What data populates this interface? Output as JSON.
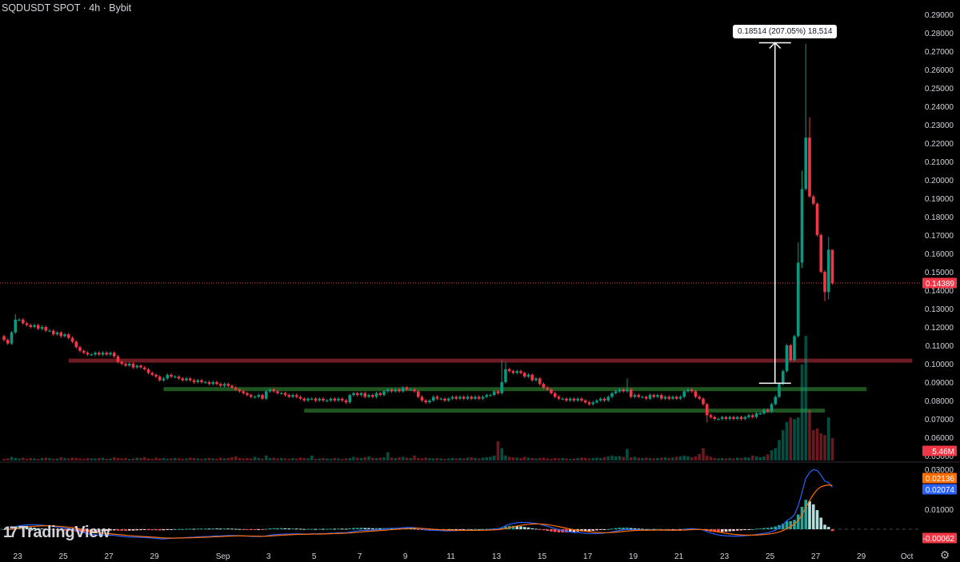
{
  "header": {
    "title": "SQDUSDT SPOT · 4h · Bybit"
  },
  "logo": {
    "text": "TradingView",
    "mark": "17"
  },
  "icons": {
    "settings": "gear-icon"
  },
  "colors": {
    "up": "#089981",
    "down": "#f23645",
    "macd": "#2962ff",
    "signal": "#ff6d00",
    "resistance": "#7a1f27",
    "support": "#1f5a22"
  },
  "chart_data": {
    "type": "candlestick",
    "symbol": "SQDUSDT",
    "interval": "4h",
    "exchange": "Bybit",
    "first_open": 0.115,
    "closes": [
      0.113,
      0.111,
      0.117,
      0.124,
      0.124,
      0.122,
      0.121,
      0.12,
      0.121,
      0.119,
      0.12,
      0.118,
      0.118,
      0.116,
      0.117,
      0.115,
      0.116,
      0.114,
      0.112,
      0.109,
      0.107,
      0.106,
      0.105,
      0.105,
      0.106,
      0.105,
      0.106,
      0.105,
      0.106,
      0.104,
      0.101,
      0.1,
      0.099,
      0.1,
      0.098,
      0.099,
      0.098,
      0.097,
      0.095,
      0.094,
      0.093,
      0.091,
      0.092,
      0.094,
      0.093,
      0.093,
      0.092,
      0.091,
      0.092,
      0.091,
      0.09,
      0.091,
      0.09,
      0.09,
      0.089,
      0.09,
      0.089,
      0.088,
      0.089,
      0.088,
      0.087,
      0.086,
      0.085,
      0.084,
      0.083,
      0.082,
      0.082,
      0.083,
      0.081,
      0.085,
      0.086,
      0.085,
      0.084,
      0.084,
      0.083,
      0.082,
      0.083,
      0.082,
      0.081,
      0.08,
      0.081,
      0.081,
      0.08,
      0.081,
      0.08,
      0.08,
      0.081,
      0.08,
      0.081,
      0.08,
      0.079,
      0.083,
      0.084,
      0.083,
      0.084,
      0.082,
      0.083,
      0.082,
      0.084,
      0.083,
      0.085,
      0.086,
      0.085,
      0.086,
      0.085,
      0.087,
      0.086,
      0.086,
      0.085,
      0.082,
      0.08,
      0.079,
      0.08,
      0.082,
      0.081,
      0.081,
      0.08,
      0.081,
      0.082,
      0.081,
      0.082,
      0.081,
      0.082,
      0.081,
      0.082,
      0.081,
      0.082,
      0.083,
      0.083,
      0.085,
      0.084,
      0.09,
      0.097,
      0.096,
      0.095,
      0.096,
      0.095,
      0.093,
      0.094,
      0.091,
      0.092,
      0.089,
      0.087,
      0.086,
      0.084,
      0.082,
      0.081,
      0.081,
      0.08,
      0.081,
      0.08,
      0.081,
      0.08,
      0.079,
      0.078,
      0.079,
      0.08,
      0.081,
      0.08,
      0.082,
      0.084,
      0.085,
      0.086,
      0.085,
      0.086,
      0.082,
      0.083,
      0.082,
      0.082,
      0.081,
      0.083,
      0.082,
      0.083,
      0.081,
      0.082,
      0.081,
      0.082,
      0.081,
      0.082,
      0.085,
      0.086,
      0.085,
      0.082,
      0.081,
      0.078,
      0.072,
      0.071,
      0.07,
      0.07,
      0.071,
      0.07,
      0.071,
      0.07,
      0.071,
      0.07,
      0.071,
      0.072,
      0.071,
      0.073,
      0.073,
      0.075,
      0.074,
      0.078,
      0.082,
      0.089,
      0.096,
      0.11,
      0.102,
      0.115,
      0.155,
      0.195,
      0.223,
      0.191,
      0.187,
      0.17,
      0.15,
      0.139,
      0.162,
      0.14389
    ],
    "wick_overrides": [
      {
        "i": 3,
        "h": 0.127
      },
      {
        "i": 131,
        "h": 0.102
      },
      {
        "i": 132,
        "h": 0.101
      },
      {
        "i": 164,
        "h": 0.092
      },
      {
        "i": 185,
        "l": 0.068
      },
      {
        "i": 209,
        "h": 0.166
      },
      {
        "i": 210,
        "h": 0.205,
        "l": 0.152
      },
      {
        "i": 211,
        "h": 0.274
      },
      {
        "i": 212,
        "h": 0.234
      },
      {
        "i": 216,
        "l": 0.134
      },
      {
        "i": 217,
        "h": 0.169,
        "l": 0.135
      },
      {
        "i": 218,
        "h": 0.162
      }
    ],
    "volume_millions": [
      0.4,
      0.5,
      0.9,
      0.6,
      0.5,
      0.7,
      0.4,
      0.6,
      0.5,
      0.4,
      0.6,
      0.7,
      0.6,
      0.4,
      0.5,
      0.8,
      0.6,
      0.5,
      0.7,
      0.6,
      0.5,
      0.4,
      0.6,
      0.5,
      0.5,
      0.6,
      0.7,
      0.4,
      0.5,
      0.8,
      0.6,
      0.5,
      0.6,
      0.4,
      0.5,
      0.7,
      0.6,
      0.8,
      0.5,
      0.4,
      0.7,
      0.5,
      0.6,
      0.4,
      0.5,
      0.6,
      0.5,
      0.4,
      0.5,
      0.7,
      0.6,
      0.5,
      0.4,
      0.5,
      0.6,
      0.5,
      0.4,
      0.7,
      0.5,
      0.6,
      0.8,
      1.0,
      0.6,
      0.5,
      0.6,
      0.5,
      0.9,
      0.6,
      0.5,
      1.2,
      0.6,
      0.7,
      0.5,
      0.6,
      0.5,
      0.4,
      0.6,
      0.5,
      0.7,
      0.6,
      0.5,
      1.2,
      0.4,
      0.5,
      0.6,
      0.5,
      0.4,
      0.6,
      0.5,
      0.4,
      0.5,
      0.6,
      0.9,
      0.7,
      0.6,
      0.8,
      1.0,
      0.7,
      0.6,
      0.7,
      0.8,
      2.0,
      0.7,
      0.6,
      0.8,
      0.9,
      0.7,
      0.6,
      1.2,
      0.6,
      0.5,
      0.7,
      0.6,
      0.5,
      0.6,
      0.5,
      0.4,
      0.5,
      0.6,
      0.5,
      0.6,
      0.5,
      0.7,
      0.8,
      0.6,
      0.5,
      0.7,
      0.8,
      0.9,
      1.2,
      4.7,
      3.0,
      1.2,
      0.9,
      0.8,
      0.7,
      0.6,
      0.9,
      0.7,
      0.6,
      0.5,
      0.6,
      0.7,
      0.5,
      0.4,
      0.6,
      0.5,
      0.6,
      0.5,
      0.4,
      0.5,
      0.6,
      0.7,
      0.6,
      0.5,
      0.6,
      0.7,
      0.6,
      0.8,
      1.0,
      1.2,
      1.0,
      1.1,
      0.9,
      2.8,
      0.8,
      0.9,
      0.7,
      0.6,
      0.7,
      0.6,
      0.5,
      0.6,
      0.7,
      0.8,
      0.6,
      0.7,
      0.9,
      1.0,
      1.2,
      1.0,
      0.8,
      1.0,
      1.6,
      3.0,
      1.2,
      0.9,
      0.6,
      0.5,
      0.6,
      0.5,
      0.6,
      0.5,
      0.7,
      0.6,
      0.8,
      0.7,
      1.2,
      1.0,
      0.8,
      1.0,
      1.5,
      2.5,
      3.0,
      5.0,
      7.4,
      9.4,
      10.5,
      10.1,
      10.5,
      23.4,
      30.4,
      12.3,
      7.4,
      7.8,
      6.6,
      6.2,
      10.5,
      5.46
    ],
    "price_axis": {
      "ticks": [
        0.29,
        0.28,
        0.27,
        0.26,
        0.25,
        0.24,
        0.23,
        0.22,
        0.21,
        0.2,
        0.19,
        0.18,
        0.17,
        0.16,
        0.15,
        0.14,
        0.13,
        0.12,
        0.11,
        0.1,
        0.09,
        0.08,
        0.07,
        0.06,
        0.05
      ],
      "decimals": 5
    },
    "last_price": "0.14389",
    "last_volume": "5.46M",
    "levels": [
      {
        "name": "resistance",
        "price": 0.1017,
        "from_index": 17,
        "to_index": 239,
        "color": "#6e1c24"
      },
      {
        "name": "support-upper",
        "price": 0.0862,
        "from_index": 42,
        "to_index": 227,
        "color": "#1e5520"
      },
      {
        "name": "support-lower",
        "price": 0.0745,
        "from_index": 79,
        "to_index": 216,
        "color": "#1e5520"
      }
    ],
    "measure": {
      "from_price": 0.08942,
      "to_price": 0.27456,
      "at_index": 205,
      "label": "0.18514 (207.05%) 18,514"
    },
    "x_axis": {
      "day_candles": 6,
      "origin_index": 3.6,
      "ticks": [
        {
          "label": "23",
          "day": 0
        },
        {
          "label": "25",
          "day": 2
        },
        {
          "label": "27",
          "day": 4
        },
        {
          "label": "29",
          "day": 6
        },
        {
          "label": "Sep",
          "day": 9
        },
        {
          "label": "3",
          "day": 11
        },
        {
          "label": "5",
          "day": 13
        },
        {
          "label": "7",
          "day": 15
        },
        {
          "label": "9",
          "day": 17
        },
        {
          "label": "11",
          "day": 19
        },
        {
          "label": "13",
          "day": 21
        },
        {
          "label": "15",
          "day": 23
        },
        {
          "label": "17",
          "day": 25
        },
        {
          "label": "19",
          "day": 27
        },
        {
          "label": "21",
          "day": 29
        },
        {
          "label": "23",
          "day": 31
        },
        {
          "label": "25",
          "day": 33
        },
        {
          "label": "27",
          "day": 35
        },
        {
          "label": "29",
          "day": 37
        },
        {
          "label": "Oct",
          "day": 39
        }
      ]
    },
    "macd": {
      "fast": 12,
      "slow": 26,
      "signal": 9,
      "axis_ticks": [
        0.03,
        0.01
      ],
      "labels": {
        "signal": "0.02136",
        "macd": "0.02074",
        "histogram": "-0.00062"
      }
    }
  }
}
